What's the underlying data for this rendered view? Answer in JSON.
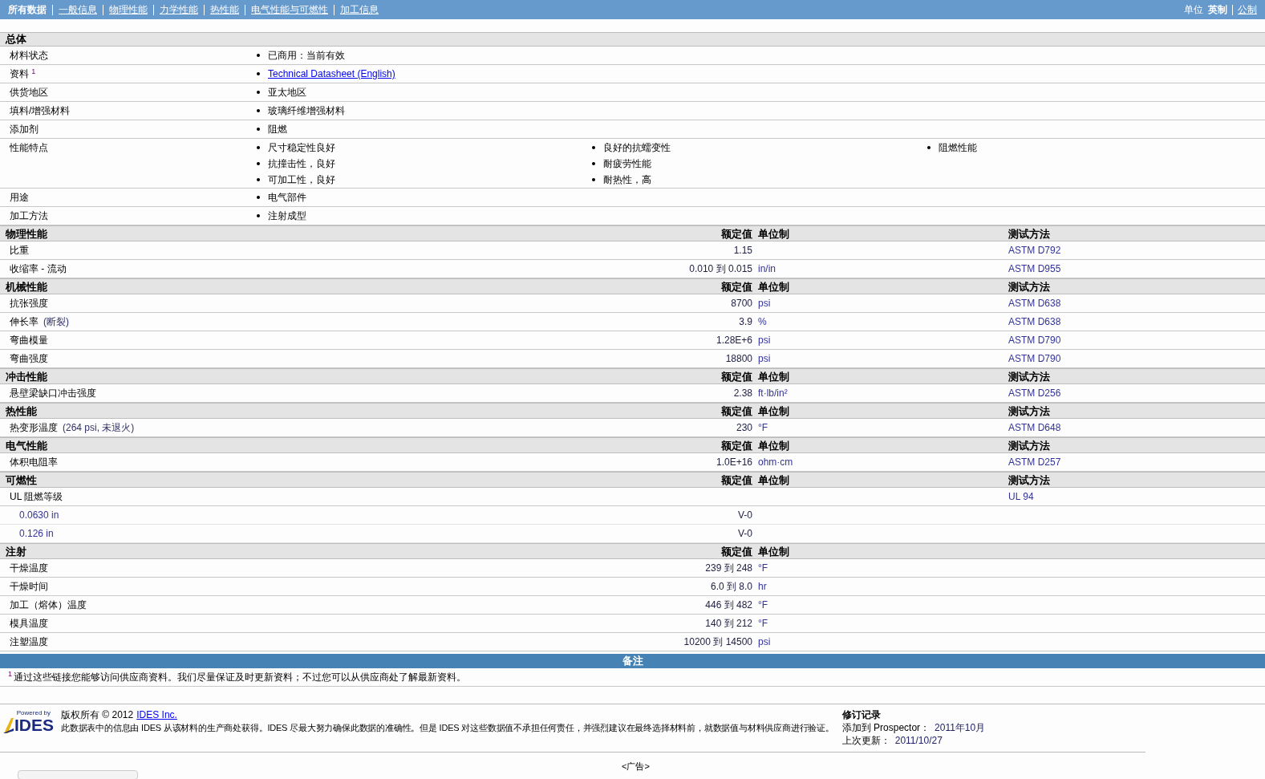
{
  "nav": {
    "items": [
      {
        "label": "所有数据",
        "selected": true
      },
      {
        "label": "一般信息",
        "selected": false
      },
      {
        "label": "物理性能",
        "selected": false
      },
      {
        "label": "力学性能",
        "selected": false
      },
      {
        "label": "热性能",
        "selected": false
      },
      {
        "label": "电气性能与可燃性",
        "selected": false
      },
      {
        "label": "加工信息",
        "selected": false
      }
    ],
    "unit_label": "单位",
    "units": [
      {
        "label": "英制",
        "selected": true
      },
      {
        "label": "公制",
        "selected": false
      }
    ]
  },
  "general": {
    "title": "总体",
    "rows": [
      {
        "label": "材料状态",
        "values": [
          {
            "kind": "text",
            "text": "已商用：当前有效"
          }
        ]
      },
      {
        "label": "资料 $^{1}$",
        "values": [
          {
            "kind": "link",
            "text": "Technical Datasheet (English)"
          }
        ]
      },
      {
        "label": "供货地区",
        "values": [
          {
            "kind": "text",
            "text": "亚太地区"
          }
        ]
      },
      {
        "label": "填料/增强材料",
        "values": [
          {
            "kind": "text",
            "text": "玻璃纤维增强材料"
          }
        ]
      },
      {
        "label": "添加剂",
        "values": [
          {
            "kind": "text",
            "text": "阻燃"
          }
        ]
      },
      {
        "label": "性能特点",
        "values": [
          {
            "kind": "text",
            "text": "尺寸稳定性良好"
          },
          {
            "kind": "text",
            "text": "抗撞击性，良好"
          },
          {
            "kind": "text",
            "text": "可加工性，良好"
          },
          {
            "kind": "text",
            "text": "良好的抗蠕变性"
          },
          {
            "kind": "text",
            "text": "耐疲劳性能"
          },
          {
            "kind": "text",
            "text": "耐热性，高"
          },
          {
            "kind": "text",
            "text": "阻燃性能"
          }
        ]
      },
      {
        "label": "用途",
        "values": [
          {
            "kind": "text",
            "text": "电气部件"
          }
        ]
      },
      {
        "label": "加工方法",
        "values": [
          {
            "kind": "text",
            "text": "注射成型"
          }
        ]
      }
    ]
  },
  "sections": [
    {
      "title": "物理性能",
      "value_heading": "额定值",
      "unit_heading": "单位制",
      "method_heading": "测试方法",
      "rows": [
        {
          "label": "比重",
          "value": "1.15",
          "method": "ASTM D792"
        },
        {
          "label": "收缩率 - 流动",
          "value": "0.010 到 0.015",
          "unit": "in/in",
          "method": "ASTM D955"
        }
      ]
    },
    {
      "title": "机械性能",
      "value_heading": "额定值",
      "unit_heading": "单位制",
      "method_heading": "测试方法",
      "rows": [
        {
          "label": "抗张强度",
          "value": "8700",
          "unit": "psi",
          "method": "ASTM D638"
        },
        {
          "label": "伸长率",
          "condition": "(断裂)",
          "value": "3.9",
          "unit": "%",
          "method": "ASTM D638"
        },
        {
          "label": "弯曲模量",
          "value": "1.28E+6",
          "unit": "psi",
          "method": "ASTM D790"
        },
        {
          "label": "弯曲强度",
          "value": "18800",
          "unit": "psi",
          "method": "ASTM D790"
        }
      ]
    },
    {
      "title": "冲击性能",
      "value_heading": "额定值",
      "unit_heading": "单位制",
      "method_heading": "测试方法",
      "rows": [
        {
          "label": "悬壁梁缺口冲击强度",
          "value": "2.38",
          "unit": "ft·lb/in²",
          "method": "ASTM D256"
        }
      ]
    },
    {
      "title": "热性能",
      "value_heading": "额定值",
      "unit_heading": "单位制",
      "method_heading": "测试方法",
      "rows": [
        {
          "label": "热变形温度",
          "condition": "(264 psi, 未退火)",
          "value": "230",
          "unit": "°F",
          "method": "ASTM D648"
        }
      ]
    },
    {
      "title": "电气性能",
      "value_heading": "额定值",
      "unit_heading": "单位制",
      "method_heading": "测试方法",
      "rows": [
        {
          "label": "体积电阻率",
          "value": "1.0E+16",
          "unit": "ohm·cm",
          "method": "ASTM D257"
        }
      ]
    },
    {
      "title": "可燃性",
      "value_heading": "额定值",
      "unit_heading": "单位制",
      "method_heading": "测试方法",
      "rows": [
        {
          "label": "UL 阻燃等级",
          "method": "UL 94",
          "children": [
            {
              "label": "0.0630 in",
              "value": "V-0"
            },
            {
              "label": "0.126 in",
              "value": "V-0"
            }
          ]
        }
      ]
    },
    {
      "title": "注射",
      "value_heading": "额定值",
      "unit_heading": "单位制",
      "rows": [
        {
          "label": "干燥温度",
          "value": "239 到 248",
          "unit": "°F"
        },
        {
          "label": "干燥时间",
          "value": "6.0 到 8.0",
          "unit": "hr"
        },
        {
          "label": "加工（熔体）温度",
          "value": "446 到 482",
          "unit": "°F"
        },
        {
          "label": "模具温度",
          "value": "140 到 212",
          "unit": "°F"
        },
        {
          "label": "注塑温度",
          "value": "10200 到 14500",
          "unit": "psi"
        }
      ]
    }
  ],
  "notes": {
    "title": "备注",
    "items": [
      "$^{1}$ 通过这些链接您能够访问供应商资料。我们尽量保证及时更新资料；不过您可以从供应商处了解最新资料。"
    ]
  },
  "footer": {
    "logo": {
      "tagline": "Powered by",
      "name": "IDES"
    },
    "copyright": "版权所有 © 2012",
    "company_link": "IDES Inc.",
    "disclaimer": "此数据表中的信息由 IDES 从该材料的生产商处获得。IDES 尽最大努力确保此数据的准确性。但是 IDES 对这些数据值不承担任何责任，并强烈建议在最终选择材料前，就数据值与材料供应商进行验证。",
    "revision": {
      "title": "修订记录",
      "lines": [
        {
          "label": "添加到 Prospector：",
          "value": "2011年10月"
        },
        {
          "label": "上次更新：",
          "value": "2011/10/27"
        }
      ]
    }
  },
  "ad_label": "<广告>"
}
